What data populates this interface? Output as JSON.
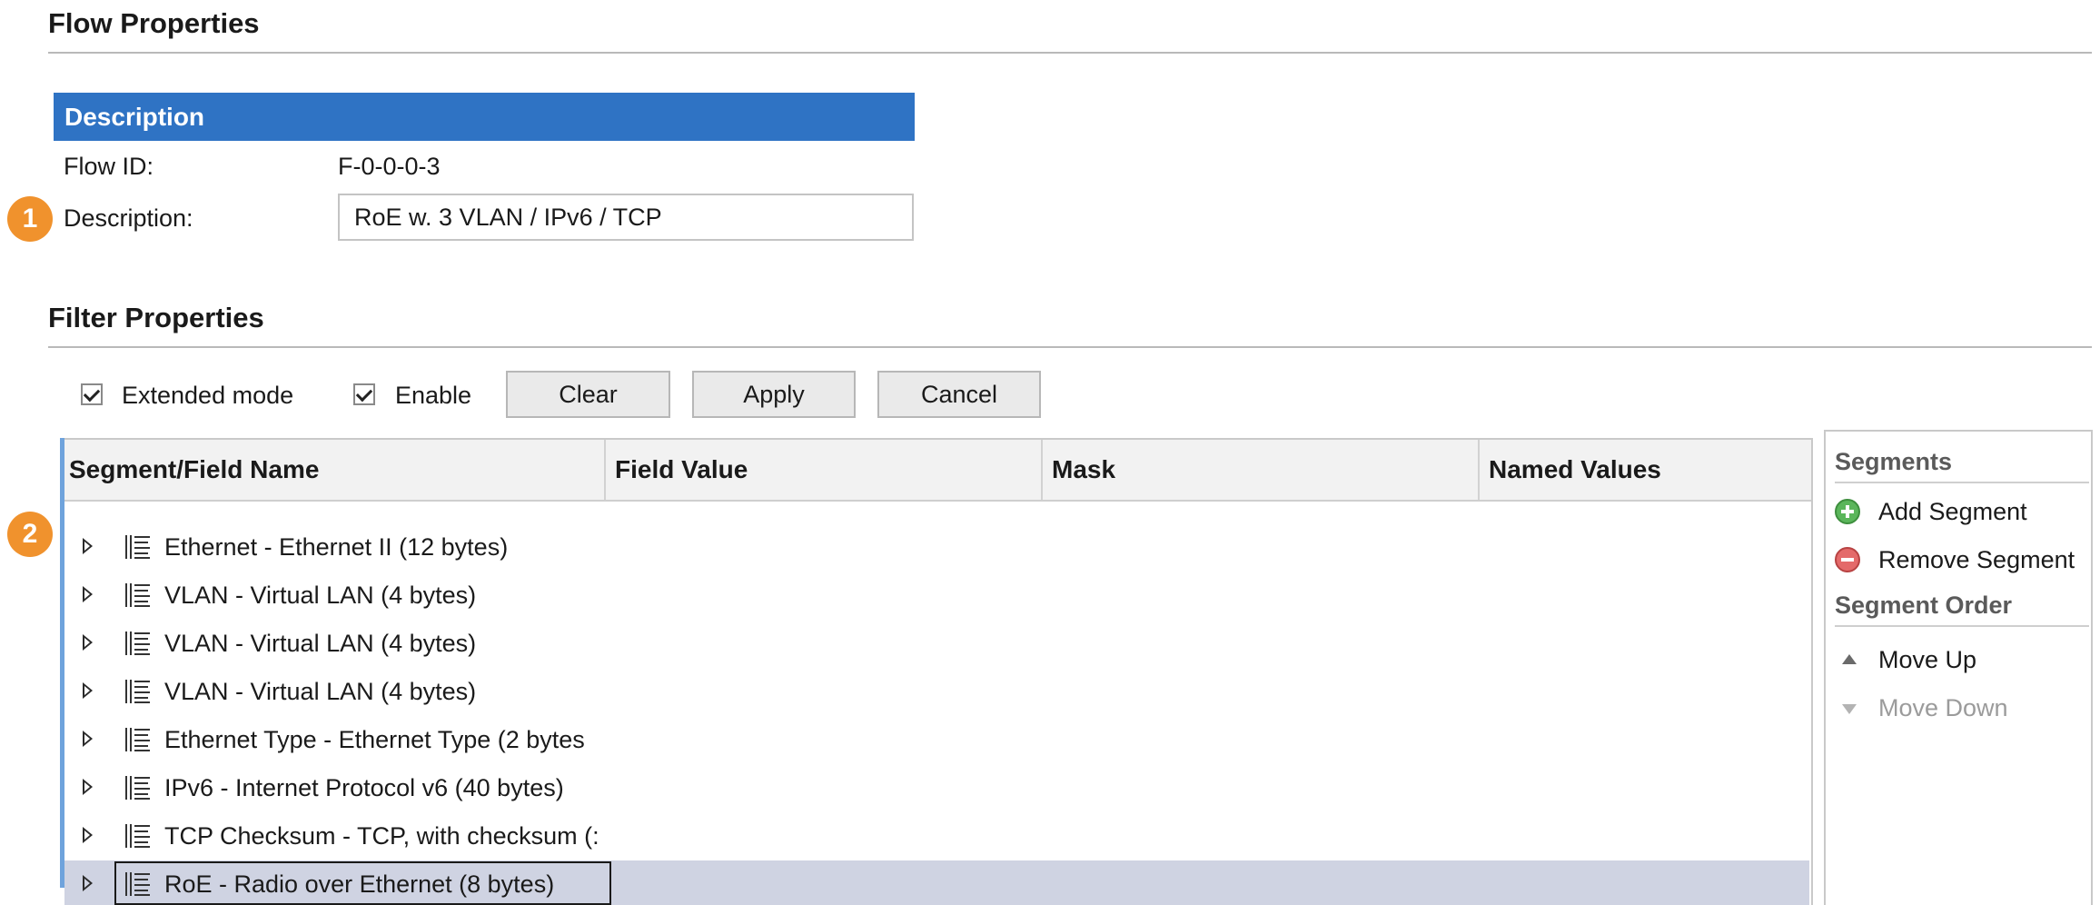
{
  "flow_properties": {
    "title": "Flow Properties",
    "description_header": "Description",
    "flow_id_label": "Flow ID:",
    "flow_id_value": "F-0-0-0-3",
    "description_label": "Description:",
    "description_value": "RoE w. 3 VLAN / IPv6 / TCP"
  },
  "badges": {
    "one": "1",
    "two": "2"
  },
  "filter_properties": {
    "title": "Filter Properties",
    "extended_mode_label": "Extended mode",
    "extended_mode_checked": true,
    "enable_label": "Enable",
    "enable_checked": true,
    "buttons": {
      "clear": "Clear",
      "apply": "Apply",
      "cancel": "Cancel"
    }
  },
  "grid": {
    "columns": [
      "Segment/Field Name",
      "Field Value",
      "Mask",
      "Named Values"
    ],
    "rows": [
      {
        "label": "Ethernet - Ethernet II (12 bytes)",
        "selected": false
      },
      {
        "label": "VLAN - Virtual LAN (4 bytes)",
        "selected": false
      },
      {
        "label": "VLAN - Virtual LAN (4 bytes)",
        "selected": false
      },
      {
        "label": "VLAN - Virtual LAN (4 bytes)",
        "selected": false
      },
      {
        "label": "Ethernet Type - Ethernet Type (2 bytes",
        "selected": false
      },
      {
        "label": "IPv6 - Internet Protocol v6 (40 bytes)",
        "selected": false
      },
      {
        "label": "TCP Checksum - TCP, with checksum (:",
        "selected": false
      },
      {
        "label": "RoE - Radio over Ethernet (8 bytes)",
        "selected": true
      }
    ]
  },
  "side_panel": {
    "segments_title": "Segments",
    "add_segment": "Add Segment",
    "remove_segment": "Remove Segment",
    "segment_order_title": "Segment Order",
    "move_up": "Move Up",
    "move_down": "Move Down"
  },
  "colors": {
    "header_blue": "#2f73c4",
    "badge_orange": "#f0922d",
    "selected_row": "#cfd3e2",
    "add_green": "#5bb65b",
    "remove_red": "#e46a6a"
  },
  "icons": {
    "expander": "triangle-right-icon",
    "segment": "segment-list-icon",
    "add": "plus-circle-icon",
    "remove": "minus-circle-icon",
    "up": "triangle-up-icon",
    "down": "triangle-down-icon"
  }
}
